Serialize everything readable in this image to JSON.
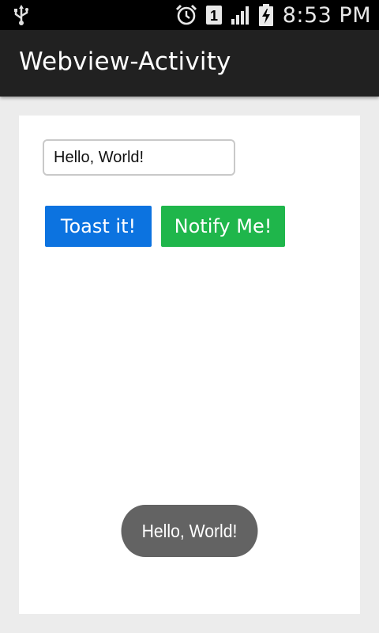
{
  "status_bar": {
    "time": "8:53 PM",
    "sim_slot": "1",
    "icons": [
      "usb-icon",
      "alarm-clock-icon",
      "sim-slot-icon",
      "signal-icon",
      "battery-charging-icon"
    ]
  },
  "action_bar": {
    "title": "Webview-Activity"
  },
  "form": {
    "input_value": "Hello, World!"
  },
  "buttons": {
    "toast_label": "Toast it!",
    "notify_label": "Notify Me!"
  },
  "toast": {
    "message": "Hello, World!"
  },
  "colors": {
    "status_bar_bg": "#000000",
    "action_bar_bg": "#212121",
    "toast_button": "#0c73e0",
    "notify_button": "#1fb64b",
    "toast_bg": "#636363",
    "page_bg": "#ececec"
  }
}
